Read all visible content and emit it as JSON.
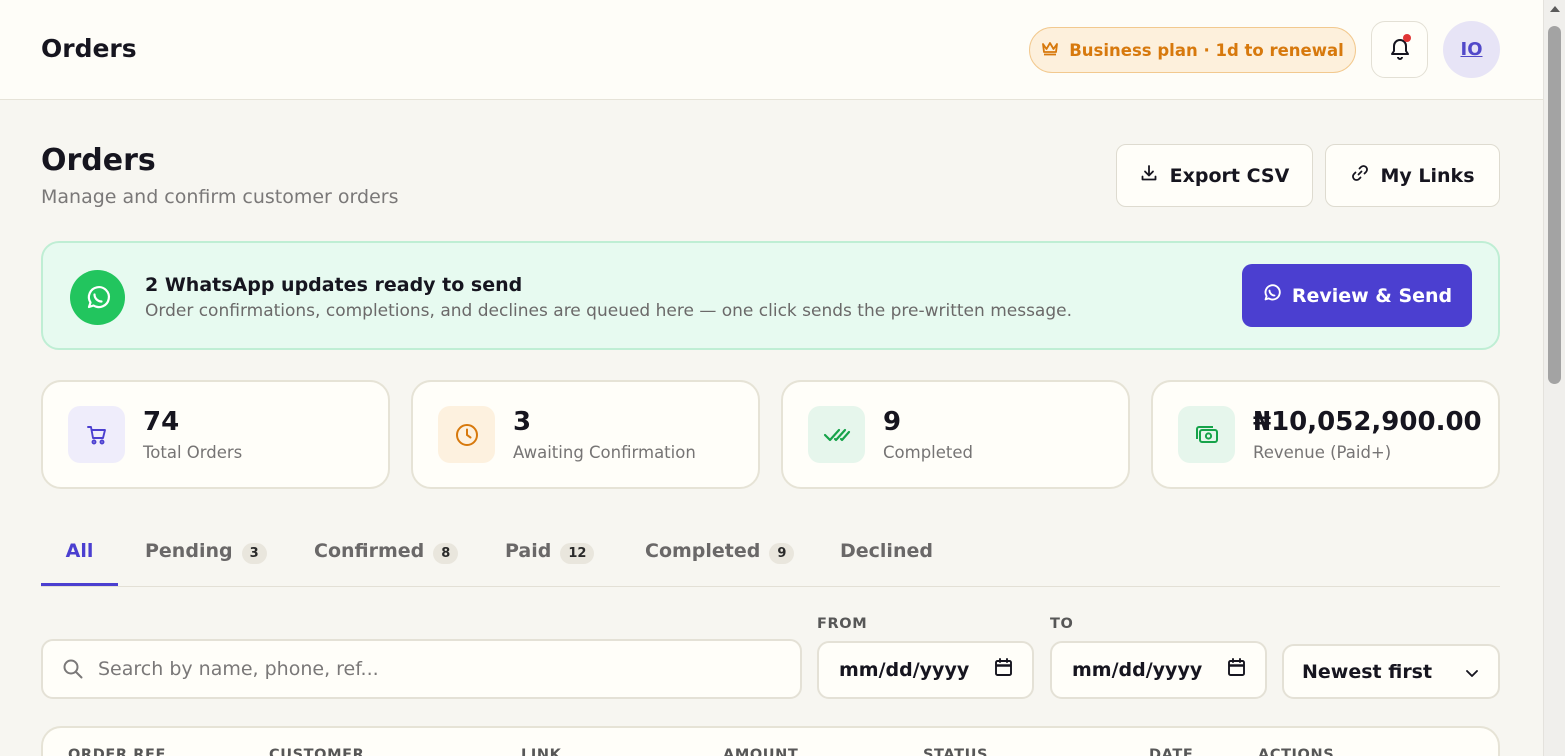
{
  "header": {
    "title": "Orders",
    "plan_badge": "Business plan · 1d to renewal",
    "avatar_initials": "IO"
  },
  "page": {
    "title": "Orders",
    "subtitle": "Manage and confirm customer orders",
    "export_label": "Export CSV",
    "links_label": "My Links"
  },
  "banner": {
    "title": "2 WhatsApp updates ready to send",
    "description": "Order confirmations, completions, and declines are queued here — one click sends the pre-written message.",
    "button_label": "Review & Send"
  },
  "stats": [
    {
      "value": "74",
      "label": "Total Orders",
      "icon": "cart-icon",
      "color": "#4b3fd0",
      "bg": "#efedfb"
    },
    {
      "value": "3",
      "label": "Awaiting Confirmation",
      "icon": "clock-icon",
      "color": "#d7790d",
      "bg": "#fdf1df"
    },
    {
      "value": "9",
      "label": "Completed",
      "icon": "double-check-icon",
      "color": "#16a34a",
      "bg": "#e6f6ec"
    },
    {
      "value": "₦10,052,900.00",
      "label": "Revenue (Paid+)",
      "icon": "cash-icon",
      "color": "#16a34a",
      "bg": "#e6f6ec"
    }
  ],
  "tabs": [
    {
      "label": "All",
      "count": ""
    },
    {
      "label": "Pending",
      "count": "3"
    },
    {
      "label": "Confirmed",
      "count": "8"
    },
    {
      "label": "Paid",
      "count": "12"
    },
    {
      "label": "Completed",
      "count": "9"
    },
    {
      "label": "Declined",
      "count": ""
    }
  ],
  "filters": {
    "search_placeholder": "Search by name, phone, ref...",
    "from_label": "FROM",
    "to_label": "TO",
    "from_value": "mm/dd/yyyy",
    "to_value": "mm/dd/yyyy",
    "sort_value": "Newest first"
  },
  "table": {
    "columns": [
      "ORDER REF",
      "CUSTOMER",
      "LINK",
      "AMOUNT",
      "STATUS",
      "DATE",
      "ACTIONS"
    ]
  },
  "colors": {
    "accent": "#4b3fd0",
    "whatsapp": "#22c55e",
    "plan": "#d7790d",
    "notification": "#e03535"
  }
}
